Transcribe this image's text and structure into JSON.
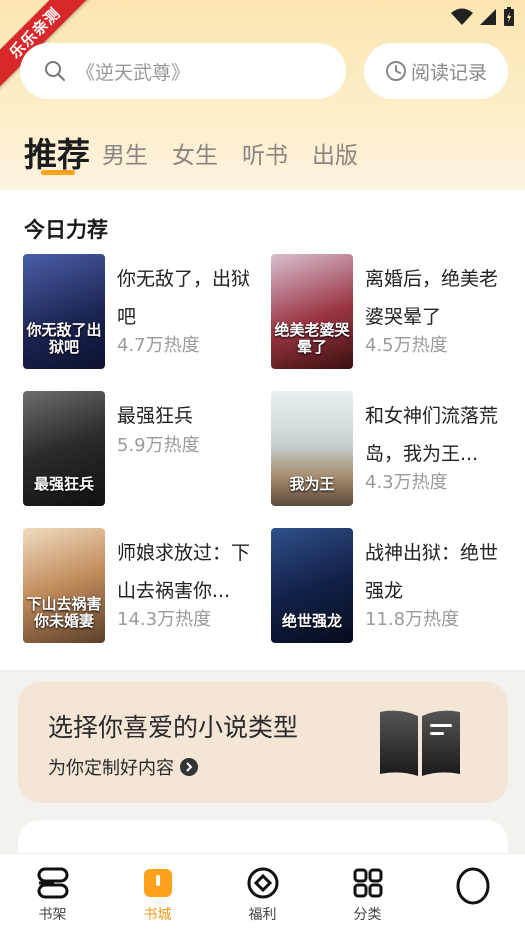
{
  "ribbon": {
    "text": "乐乐亲测"
  },
  "search": {
    "placeholder": "《逆天武尊》"
  },
  "history": {
    "label": "阅读记录"
  },
  "tabs": [
    {
      "label": "推荐",
      "active": true
    },
    {
      "label": "男生",
      "active": false
    },
    {
      "label": "女生",
      "active": false
    },
    {
      "label": "听书",
      "active": false
    },
    {
      "label": "出版",
      "active": false
    }
  ],
  "section": {
    "title": "今日力荐"
  },
  "books": [
    {
      "title": "你无敌了，出狱吧",
      "heat": "4.7万热度",
      "cover_text": "你无敌了出狱吧",
      "cover_color": "#2c3d78"
    },
    {
      "title": "离婚后，绝美老婆哭晕了",
      "heat": "4.5万热度",
      "cover_text": "绝美老婆哭晕了",
      "cover_color": "#b02a3a"
    },
    {
      "title": "最强狂兵",
      "heat": "5.9万热度",
      "cover_text": "最强狂兵",
      "cover_color": "#2a2a2a"
    },
    {
      "title": "和女神们流落荒岛，我为王...",
      "heat": "4.3万热度",
      "cover_text": "我为王",
      "cover_color": "#6b7f88"
    },
    {
      "title": "师娘求放过：下山去祸害你...",
      "heat": "14.3万热度",
      "cover_text": "下山去祸害你未婚妻",
      "cover_color": "#c59a6a"
    },
    {
      "title": "战神出狱：绝世强龙",
      "heat": "11.8万热度",
      "cover_text": "绝世强龙",
      "cover_color": "#13224a"
    }
  ],
  "banner": {
    "title": "选择你喜爱的小说类型",
    "subtitle": "为你定制好内容"
  },
  "nav": [
    {
      "label": "书架",
      "icon": "bookshelf-icon",
      "active": false
    },
    {
      "label": "书城",
      "icon": "bookstore-icon",
      "active": true
    },
    {
      "label": "福利",
      "icon": "welfare-icon",
      "active": false
    },
    {
      "label": "分类",
      "icon": "category-icon",
      "active": false
    },
    {
      "label": "",
      "icon": "profile-icon",
      "active": false
    }
  ],
  "colors": {
    "accent": "#ffa21a",
    "header_bg": "#fbe6b0",
    "banner_bg": "#f3e6d6"
  }
}
